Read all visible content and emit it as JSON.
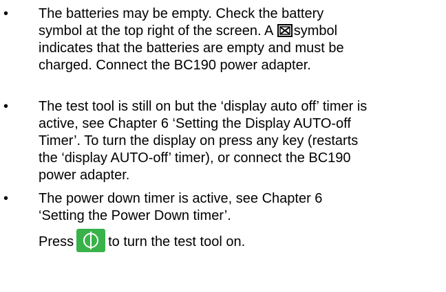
{
  "items": [
    {
      "bullet": "•",
      "lines": [
        "The batteries may be empty. Check the battery",
        "symbol at the top right of the screen. A ",
        "symbol",
        "indicates that the batteries are empty and must be",
        "charged. Connect the BC190 power adapter."
      ],
      "inline_icon": "battery-empty-icon"
    },
    {
      "bullet": "•",
      "lines": [
        "The test tool is still on but the ‘display auto off’ timer is",
        "active, see Chapter 6 ‘Setting the Display AUTO-off",
        "Timer’. To turn the display on press any key (restarts",
        "the ‘display AUTO-off’ timer), or connect the BC190",
        "power adapter."
      ]
    },
    {
      "bullet": "•",
      "lines": [
        "The power down timer is active, see Chapter 6",
        "‘Setting the Power Down timer’.",
        "Press",
        "to turn the test tool on."
      ],
      "inline_icon": "power-button-icon"
    }
  ],
  "colors": {
    "text": "#000000",
    "power_button_fill": "#39b24a",
    "power_button_symbol": "#ffffff"
  }
}
